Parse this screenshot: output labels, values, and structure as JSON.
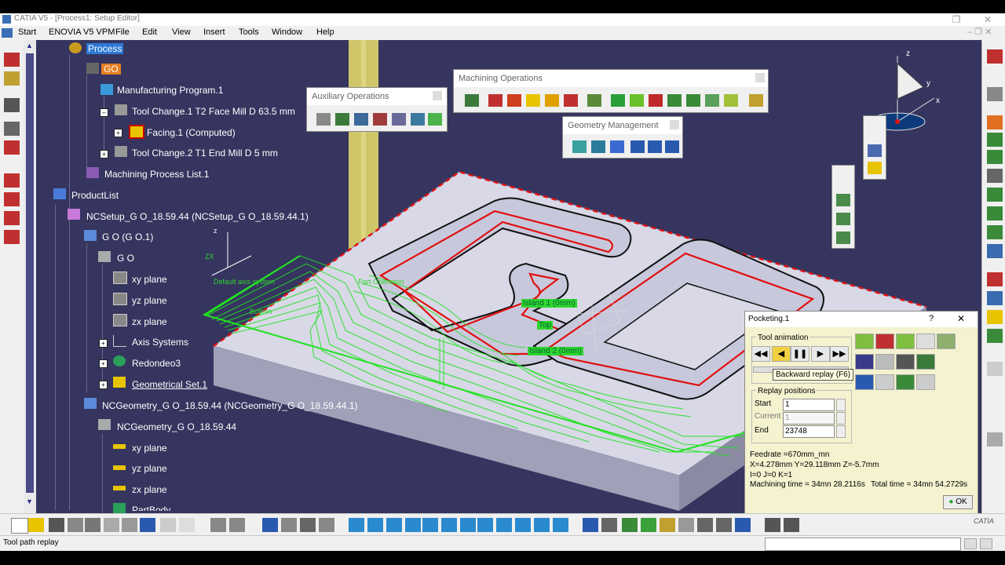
{
  "window": {
    "title": "CATIA V5 - [Process1: Setup Editor]"
  },
  "menubar": [
    "Start",
    "ENOVIA V5 VPM",
    "File",
    "Edit",
    "View",
    "Insert",
    "Tools",
    "Window",
    "Help"
  ],
  "tree": [
    {
      "label": "Process",
      "selected": true
    },
    {
      "label": "GO"
    },
    {
      "label": "Manufacturing Program.1"
    },
    {
      "label": "Tool Change.1  T2 Face Mill D 63.5 mm"
    },
    {
      "label": "Facing.1 (Computed)"
    },
    {
      "label": "Tool Change.2  T1 End Mill D 5 mm"
    },
    {
      "label": "Machining Process List.1"
    },
    {
      "label": "ProductList"
    },
    {
      "label": "NCSetup_G O_18.59.44 (NCSetup_G O_18.59.44.1)"
    },
    {
      "label": "G O (G O.1)"
    },
    {
      "label": "G O"
    },
    {
      "label": "xy plane"
    },
    {
      "label": "yz plane"
    },
    {
      "label": "zx plane"
    },
    {
      "label": "Axis Systems"
    },
    {
      "label": "Redondeo3"
    },
    {
      "label": "Geometrical Set.1"
    },
    {
      "label": "NCGeometry_G O_18.59.44 (NCGeometry_G O_18.59.44.1)"
    },
    {
      "label": "NCGeometry_G O_18.59.44"
    },
    {
      "label": "xy plane"
    },
    {
      "label": "yz plane"
    },
    {
      "label": "zx plane"
    },
    {
      "label": "PartBody"
    }
  ],
  "toolbars": {
    "auxiliary": "Auxiliary Operations",
    "machining": "Machining Operations",
    "geometry": "Geometry Management"
  },
  "viewport_labels": {
    "island1": "Island 1 (0mm)",
    "top": "Top",
    "island2": "Island 2 (0mm)",
    "default_axis": "Default axis system",
    "part_operation": "Part Operation",
    "bottom": "Bottom",
    "axis_x": "x",
    "axis_y": "y",
    "axis_z": "z",
    "zx_label": "ZX"
  },
  "dialog": {
    "title": "Pocketing.1",
    "help": "?",
    "close": "✕",
    "tool_animation": "Tool animation",
    "tooltip": "Backward replay (F6)",
    "replay_positions": "Replay positions",
    "start_label": "Start",
    "start_value": "1",
    "current_label": "Current",
    "current_value": "1",
    "end_label": "End",
    "end_value": "23748",
    "feedrate": "Feedrate =670mm_mn",
    "coords": "X=4.278mm Y=29.118mm Z=-5.7mm",
    "ijk": "I=0 J=0 K=1",
    "machining_time": "Machining time = 34mn 28.2116s",
    "total_time": "Total time = 34mn 54.2729s",
    "ok": "OK"
  },
  "status": {
    "text": "Tool path replay"
  },
  "brand": "CATIA",
  "colors": {
    "viewport": "#35355f",
    "toolpath": "#21e321",
    "contour": "#e01010",
    "dialog": "#f4f2cf"
  }
}
